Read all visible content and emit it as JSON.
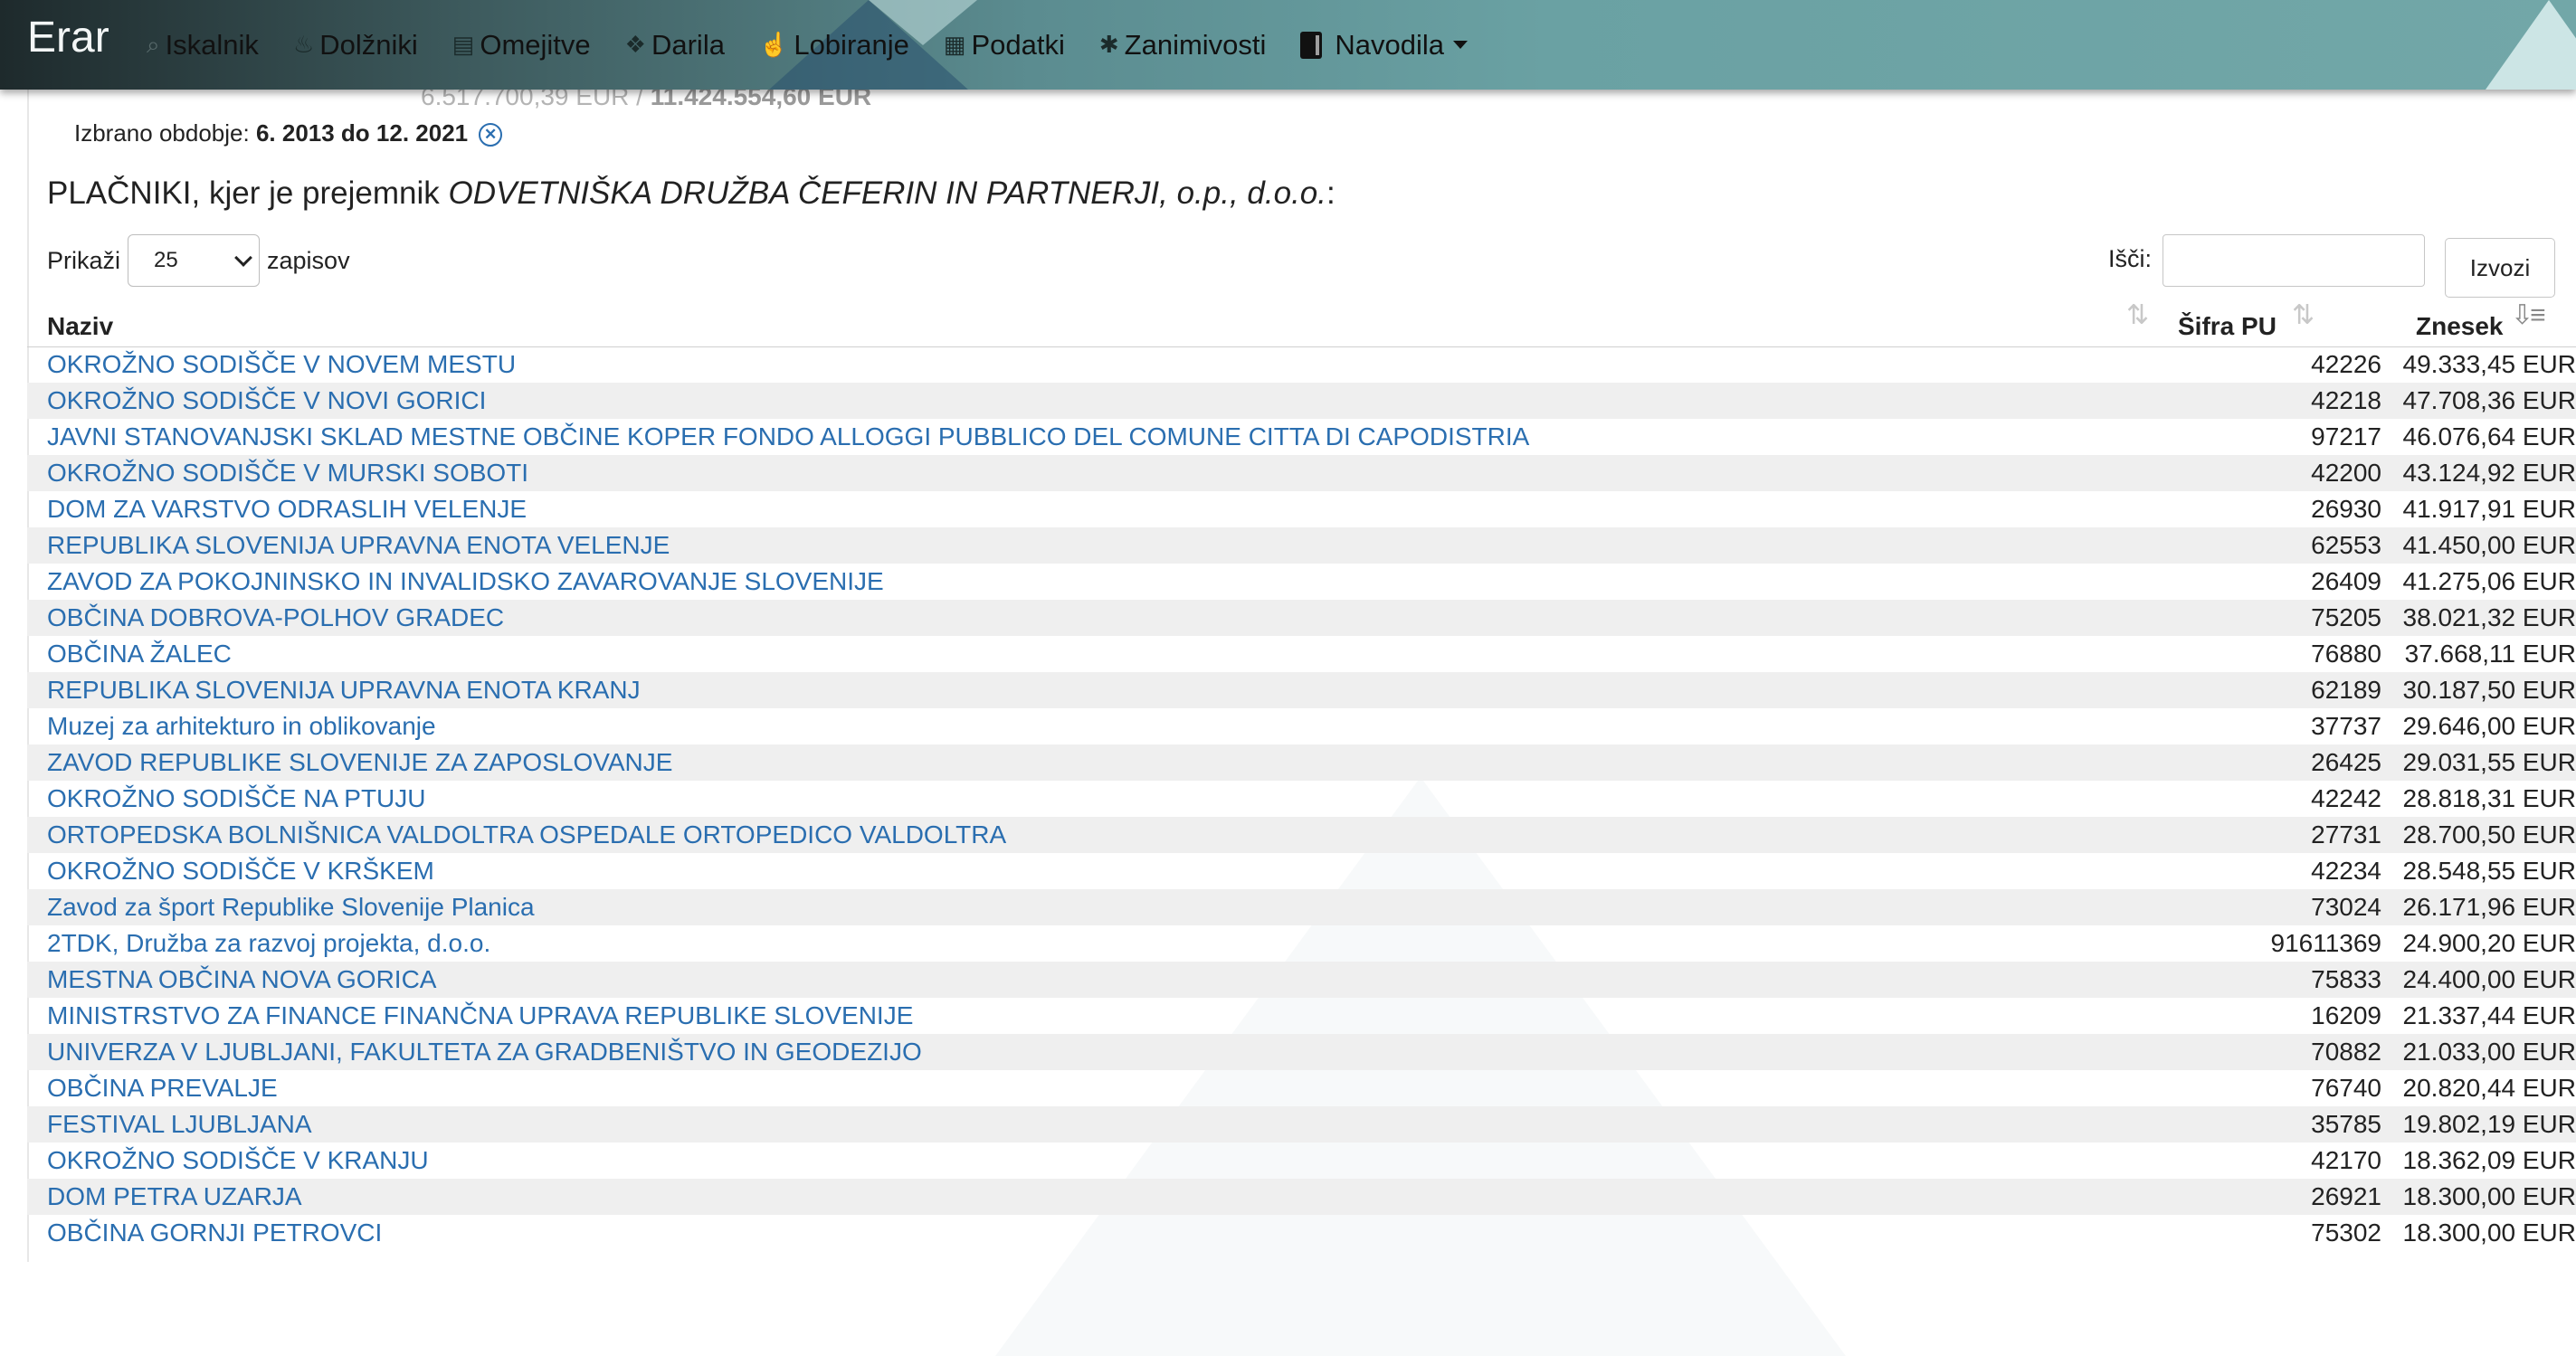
{
  "navbar": {
    "brand": "Erar",
    "items": [
      {
        "label": "Iskalnik",
        "icon": "search-icon"
      },
      {
        "label": "Dolžniki",
        "icon": "fire-icon"
      },
      {
        "label": "Omejitve",
        "icon": "briefcase-icon"
      },
      {
        "label": "Darila",
        "icon": "gift-icon"
      },
      {
        "label": "Lobiranje",
        "icon": "hand-pointer-icon"
      },
      {
        "label": "Podatki",
        "icon": "grid-icon"
      },
      {
        "label": "Zanimivosti",
        "icon": "asterisk-icon"
      },
      {
        "label": "Navodila",
        "icon": "book-icon"
      }
    ]
  },
  "ghost_line": {
    "left": "6.517.700,39 EUR /",
    "right": "11.424.554,60 EUR"
  },
  "period": {
    "label": "Izbrano obdobje:",
    "value": "6. 2013 do 12. 2021"
  },
  "heading": {
    "prefix": "PLAČNIKI, kjer je prejemnik ",
    "recipient": "ODVETNIŠKA DRUŽBA ČEFERIN IN PARTNERJI, o.p., d.o.o.",
    "suffix": ":"
  },
  "length_control": {
    "before": "Prikaži",
    "value": "25",
    "after": "zapisov"
  },
  "search": {
    "label": "Išči:",
    "value": ""
  },
  "export_label": "Izvozi",
  "table": {
    "headers": {
      "name": "Naziv",
      "code": "Šifra PU",
      "amount": "Znesek"
    },
    "rows": [
      {
        "name": "OKROŽNO SODIŠČE V NOVEM MESTU",
        "code": "42226",
        "amount": "49.333,45 EUR"
      },
      {
        "name": "OKROŽNO SODIŠČE V NOVI GORICI",
        "code": "42218",
        "amount": "47.708,36 EUR"
      },
      {
        "name": "JAVNI STANOVANJSKI SKLAD MESTNE OBČINE KOPER FONDO ALLOGGI PUBBLICO DEL COMUNE CITTA DI CAPODISTRIA",
        "code": "97217",
        "amount": "46.076,64 EUR"
      },
      {
        "name": "OKROŽNO SODIŠČE V MURSKI SOBOTI",
        "code": "42200",
        "amount": "43.124,92 EUR"
      },
      {
        "name": "DOM ZA VARSTVO ODRASLIH VELENJE",
        "code": "26930",
        "amount": "41.917,91 EUR"
      },
      {
        "name": "REPUBLIKA SLOVENIJA UPRAVNA ENOTA VELENJE",
        "code": "62553",
        "amount": "41.450,00 EUR"
      },
      {
        "name": "ZAVOD ZA POKOJNINSKO IN INVALIDSKO ZAVAROVANJE SLOVENIJE",
        "code": "26409",
        "amount": "41.275,06 EUR"
      },
      {
        "name": "OBČINA DOBROVA-POLHOV GRADEC",
        "code": "75205",
        "amount": "38.021,32 EUR"
      },
      {
        "name": "OBČINA ŽALEC",
        "code": "76880",
        "amount": "37.668,11 EUR"
      },
      {
        "name": "REPUBLIKA SLOVENIJA UPRAVNA ENOTA KRANJ",
        "code": "62189",
        "amount": "30.187,50 EUR"
      },
      {
        "name": "Muzej za arhitekturo in oblikovanje",
        "code": "37737",
        "amount": "29.646,00 EUR"
      },
      {
        "name": "ZAVOD REPUBLIKE SLOVENIJE ZA ZAPOSLOVANJE",
        "code": "26425",
        "amount": "29.031,55 EUR"
      },
      {
        "name": "OKROŽNO SODIŠČE NA PTUJU",
        "code": "42242",
        "amount": "28.818,31 EUR"
      },
      {
        "name": "ORTOPEDSKA BOLNIŠNICA VALDOLTRA OSPEDALE ORTOPEDICO VALDOLTRA",
        "code": "27731",
        "amount": "28.700,50 EUR"
      },
      {
        "name": "OKROŽNO SODIŠČE V KRŠKEM",
        "code": "42234",
        "amount": "28.548,55 EUR"
      },
      {
        "name": "Zavod za šport Republike Slovenije Planica",
        "code": "73024",
        "amount": "26.171,96 EUR"
      },
      {
        "name": "2TDK, Družba za razvoj projekta, d.o.o.",
        "code": "91611369",
        "amount": "24.900,20 EUR"
      },
      {
        "name": "MESTNA OBČINA NOVA GORICA",
        "code": "75833",
        "amount": "24.400,00 EUR"
      },
      {
        "name": "MINISTRSTVO ZA FINANCE FINANČNA UPRAVA REPUBLIKE SLOVENIJE",
        "code": "16209",
        "amount": "21.337,44 EUR"
      },
      {
        "name": "UNIVERZA V LJUBLJANI, FAKULTETA ZA GRADBENIŠTVO IN GEODEZIJO",
        "code": "70882",
        "amount": "21.033,00 EUR"
      },
      {
        "name": "OBČINA PREVALJE",
        "code": "76740",
        "amount": "20.820,44 EUR"
      },
      {
        "name": "FESTIVAL LJUBLJANA",
        "code": "35785",
        "amount": "19.802,19 EUR"
      },
      {
        "name": "OKROŽNO SODIŠČE V KRANJU",
        "code": "42170",
        "amount": "18.362,09 EUR"
      },
      {
        "name": "DOM PETRA UZARJA",
        "code": "26921",
        "amount": "18.300,00 EUR"
      },
      {
        "name": "OBČINA GORNJI PETROVCI",
        "code": "75302",
        "amount": "18.300,00 EUR"
      }
    ]
  },
  "colors": {
    "link": "#2a6eb0",
    "stripe": "#efefef",
    "navbar_start": "#1e2a2c",
    "navbar_end": "#72a7a8"
  }
}
